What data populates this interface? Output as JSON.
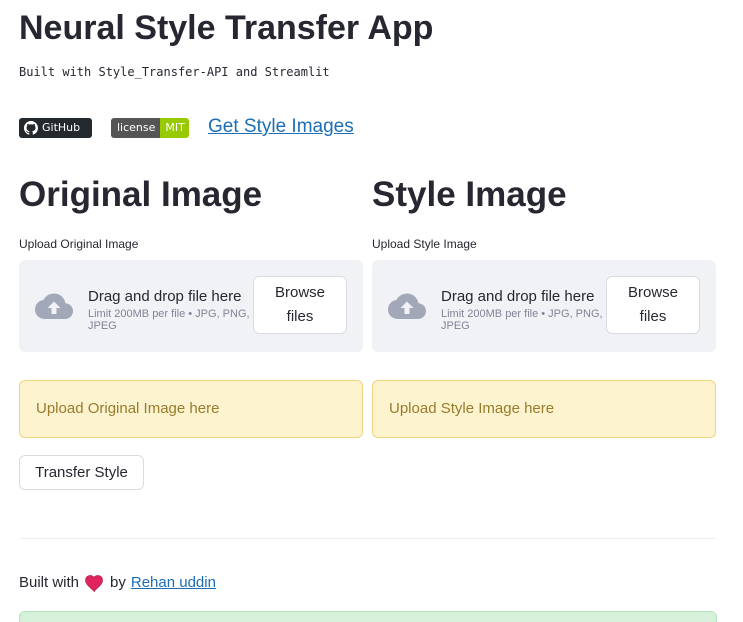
{
  "app": {
    "title": "Neural Style Transfer App",
    "subtitle": "Built with Style_Transfer-API and Streamlit"
  },
  "badges": {
    "github_label": "GitHub",
    "license_left": "license",
    "license_right": "MIT",
    "license_color": "#97ca00"
  },
  "links": {
    "get_style_images": "Get Style Images"
  },
  "original": {
    "heading": "Original Image",
    "upload_label": "Upload Original Image",
    "drop_text": "Drag and drop file here",
    "limit_text": "Limit 200MB per file • JPG, PNG, JPEG",
    "browse_line1": "Browse",
    "browse_line2": "files",
    "warning": "Upload Original Image here"
  },
  "style": {
    "heading": "Style Image",
    "upload_label": "Upload Style Image",
    "drop_text": "Drag and drop file here",
    "limit_text": "Limit 200MB per file • JPG, PNG, JPEG",
    "browse_line1": "Browse",
    "browse_line2": "files",
    "warning": "Upload Style Image here"
  },
  "actions": {
    "transfer_label": "Transfer Style"
  },
  "footer": {
    "built_with": "Built with",
    "by": "by",
    "author": "Rehan uddin"
  },
  "colors": {
    "link": "#1c6eb7",
    "warning_bg": "#fdf3cf",
    "warning_text": "#977c2c",
    "dropzone_bg": "#f0f2f6",
    "success_bg": "#d6f0da",
    "heart": "#e0245e"
  },
  "icons": {
    "cloud": "cloud-upload-icon",
    "github": "github-icon",
    "heart": "heart-icon"
  }
}
